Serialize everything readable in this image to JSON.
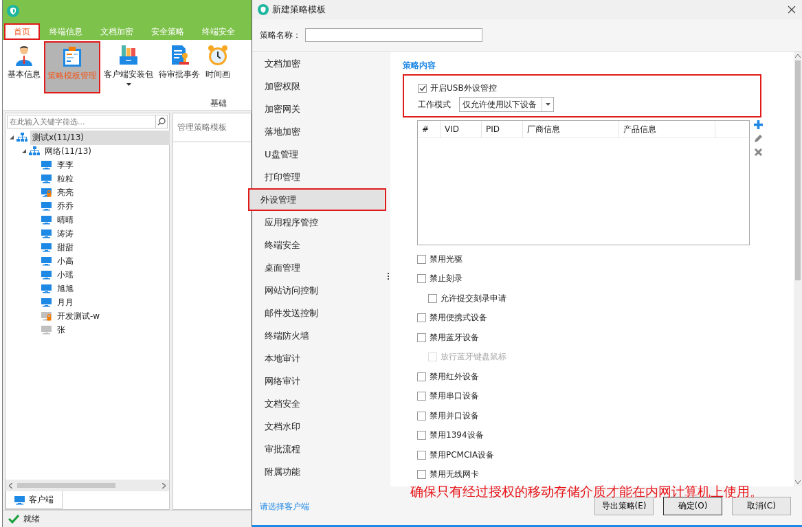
{
  "app": {
    "tabs": [
      {
        "label": "首页",
        "selected": true,
        "highlighted": true
      },
      {
        "label": "终端信息",
        "selected": false,
        "highlighted": false
      },
      {
        "label": "文档加密",
        "selected": false,
        "highlighted": false
      },
      {
        "label": "安全策略",
        "selected": false,
        "highlighted": false
      },
      {
        "label": "终端安全",
        "selected": false,
        "highlighted": false
      }
    ],
    "ribbon": {
      "buttons": [
        {
          "label": "基本信息",
          "selected": false,
          "highlighted": false,
          "dropdown": false
        },
        {
          "label": "策略模板管理",
          "selected": true,
          "highlighted": true,
          "dropdown": false
        },
        {
          "label": "客户端安装包",
          "selected": false,
          "highlighted": false,
          "dropdown": true
        },
        {
          "label": "待审批事务",
          "selected": false,
          "highlighted": false,
          "dropdown": false
        },
        {
          "label": "时间画",
          "selected": false,
          "highlighted": false,
          "dropdown": false
        }
      ],
      "group_label": "基础"
    },
    "tree_search": {
      "placeholder": "在此输入关键字筛选..."
    },
    "tree": [
      {
        "label": "测试x(11/13)",
        "kind": "group",
        "selected": true,
        "expanded": true,
        "children": [
          {
            "label": "网络(11/13)",
            "kind": "group",
            "selected": false,
            "expanded": true,
            "children": [
              {
                "label": "李李",
                "kind": "online",
                "selected": false
              },
              {
                "label": "粒粒",
                "kind": "online",
                "selected": false
              },
              {
                "label": "亮亮",
                "kind": "locked",
                "selected": false
              },
              {
                "label": "乔乔",
                "kind": "online",
                "selected": false
              },
              {
                "label": "晴晴",
                "kind": "online",
                "selected": false
              },
              {
                "label": "涛涛",
                "kind": "online",
                "selected": false
              },
              {
                "label": "甜甜",
                "kind": "online",
                "selected": false
              },
              {
                "label": "小高",
                "kind": "online",
                "selected": false
              },
              {
                "label": "小瑶",
                "kind": "online",
                "selected": false
              },
              {
                "label": "旭旭",
                "kind": "online",
                "selected": false
              },
              {
                "label": "月月",
                "kind": "online",
                "selected": false
              },
              {
                "label": "开发测试-w",
                "kind": "offline_locked",
                "selected": false
              },
              {
                "label": "张",
                "kind": "offline",
                "selected": false
              }
            ]
          }
        ]
      }
    ],
    "bottom_tab": "客户端",
    "side_pane": {
      "title": "管理策略模板"
    },
    "status_bar": "就绪"
  },
  "dialog": {
    "title": "新建策略模板",
    "name_field": {
      "label": "策略名称："
    },
    "nav": [
      {
        "label": "文档加密",
        "selected": false,
        "highlighted": false
      },
      {
        "label": "加密权限",
        "selected": false,
        "highlighted": false
      },
      {
        "label": "加密网关",
        "selected": false,
        "highlighted": false
      },
      {
        "label": "落地加密",
        "selected": false,
        "highlighted": false
      },
      {
        "label": "U盘管理",
        "selected": false,
        "highlighted": false
      },
      {
        "label": "打印管理",
        "selected": false,
        "highlighted": false
      },
      {
        "label": "外设管理",
        "selected": true,
        "highlighted": true
      },
      {
        "label": "应用程序管控",
        "selected": false,
        "highlighted": false
      },
      {
        "label": "终端安全",
        "selected": false,
        "highlighted": false
      },
      {
        "label": "桌面管理",
        "selected": false,
        "highlighted": false
      },
      {
        "label": "网站访问控制",
        "selected": false,
        "highlighted": false
      },
      {
        "label": "邮件发送控制",
        "selected": false,
        "highlighted": false
      },
      {
        "label": "终端防火墙",
        "selected": false,
        "highlighted": false
      },
      {
        "label": "本地审计",
        "selected": false,
        "highlighted": false
      },
      {
        "label": "网络审计",
        "selected": false,
        "highlighted": false
      },
      {
        "label": "文档安全",
        "selected": false,
        "highlighted": false
      },
      {
        "label": "文档水印",
        "selected": false,
        "highlighted": false
      },
      {
        "label": "审批流程",
        "selected": false,
        "highlighted": false
      },
      {
        "label": "附属功能",
        "selected": false,
        "highlighted": false
      }
    ],
    "section_title": "策略内容",
    "usb_group": {
      "highlighted": true,
      "enable": {
        "label": "开启USB外设管控",
        "checked": true
      },
      "work_mode": {
        "label": "工作模式",
        "value": "仅允许使用以下设备"
      }
    },
    "device_table": {
      "columns": [
        "#",
        "VID",
        "PID",
        "厂商信息",
        "产品信息"
      ]
    },
    "options": [
      {
        "label": "禁用光驱",
        "checked": false,
        "disabled": false
      },
      {
        "label": "禁止刻录",
        "checked": false,
        "disabled": false,
        "children": [
          {
            "label": "允许提交刻录申请",
            "checked": false,
            "disabled": false
          }
        ]
      },
      {
        "label": "禁用便携式设备",
        "checked": false,
        "disabled": false
      },
      {
        "label": "禁用蓝牙设备",
        "checked": false,
        "disabled": false,
        "children": [
          {
            "label": "放行蓝牙键盘鼠标",
            "checked": false,
            "disabled": true
          }
        ]
      },
      {
        "label": "禁用红外设备",
        "checked": false,
        "disabled": false
      },
      {
        "label": "禁用串口设备",
        "checked": false,
        "disabled": false
      },
      {
        "label": "禁用并口设备",
        "checked": false,
        "disabled": false
      },
      {
        "label": "禁用1394设备",
        "checked": false,
        "disabled": false
      },
      {
        "label": "禁用PCMCIA设备",
        "checked": false,
        "disabled": false
      },
      {
        "label": "禁用无线网卡",
        "checked": false,
        "disabled": false
      }
    ],
    "footer_link": "请选择客户端",
    "buttons": [
      {
        "label": "导出策略(E)",
        "default": false
      },
      {
        "label": "确定(O)",
        "default": true
      },
      {
        "label": "取消(C)",
        "default": false
      }
    ]
  },
  "annotation": "确保只有经过授权的移动存储介质才能在内网计算机上使用。"
}
